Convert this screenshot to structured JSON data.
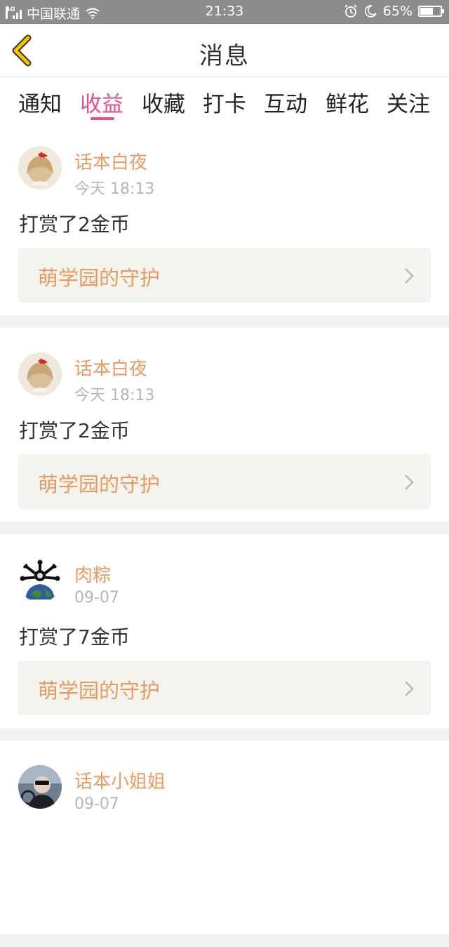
{
  "status_bar": {
    "network_tag": "4G",
    "carrier": "中国联通",
    "time": "21:33",
    "battery_text": "65%",
    "battery_level": 0.65
  },
  "header": {
    "title": "消息",
    "back_icon": "chevron-left-icon",
    "accent_color": "#f5c400"
  },
  "tabs": [
    {
      "label": "通知",
      "active": false
    },
    {
      "label": "收益",
      "active": true
    },
    {
      "label": "收藏",
      "active": false
    },
    {
      "label": "打卡",
      "active": false
    },
    {
      "label": "互动",
      "active": false
    },
    {
      "label": "鲜花",
      "active": false
    },
    {
      "label": "关注",
      "active": false
    }
  ],
  "messages": [
    {
      "user": "话本白夜",
      "time": "今天 18:13",
      "text": "打赏了2金币",
      "link": "萌学园的守护",
      "avatar_icon": "girl-red-bow-avatar"
    },
    {
      "user": "话本白夜",
      "time": "今天 18:13",
      "text": "打赏了2金币",
      "link": "萌学园的守护",
      "avatar_icon": "girl-red-bow-avatar"
    },
    {
      "user": "肉粽",
      "time": "09-07",
      "text": "打赏了7金币",
      "link": "萌学园的守护",
      "avatar_icon": "earth-bones-avatar"
    },
    {
      "user": "话本小姐姐",
      "time": "09-07",
      "text": "",
      "link": "",
      "avatar_icon": "driver-photo-avatar"
    }
  ],
  "colors": {
    "tab_active": "#e4508a",
    "username": "#e89a62",
    "link_text": "#e89a62",
    "link_bg": "#f4f4ef"
  }
}
